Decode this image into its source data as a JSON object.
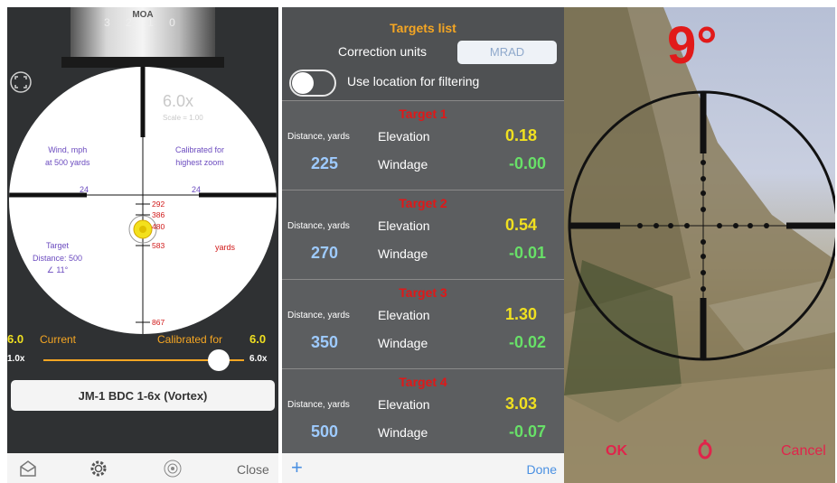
{
  "left_panel": {
    "turret": {
      "label": "MOA",
      "numbers": "3 2 1 0"
    },
    "reticle": {
      "zoom_display": "6.0x",
      "scale_text": "Scale = 1.00",
      "wind_label_line1": "Wind, mph",
      "wind_label_line2": "at 500 yards",
      "calibrated_line1": "Calibrated for",
      "calibrated_line2": "highest zoom",
      "wind_left_value": "24",
      "wind_right_value": "24",
      "holdover_marks": [
        "292",
        "386",
        "480",
        "583",
        "867"
      ],
      "target_line1": "Target",
      "target_line2": "Distance: 500",
      "target_line3": "∠ 11°",
      "yards_label": "yards"
    },
    "zoom_slider": {
      "current_value": "6.0",
      "current_label": "Current",
      "calibrated_label": "Calibrated for",
      "calibrated_value": "6.0",
      "min_label": "1.0x",
      "max_label": "6.0x",
      "position_fraction": 1.0
    },
    "reticle_name": "JM-1 BDC 1-6x (Vortex)"
  },
  "toolbar_left": {
    "items": [
      "share-icon",
      "gear-icon",
      "target-icon"
    ],
    "close_label": "Close"
  },
  "middle_panel": {
    "title": "Targets list",
    "correction_units_label": "Correction units",
    "correction_units_value": "MRAD",
    "use_location_label": "Use location for filtering",
    "use_location_on": false,
    "targets": [
      {
        "title": "Target 1",
        "distance_label": "Distance, yards",
        "distance": "225",
        "elevation_label": "Elevation",
        "elevation": "0.18",
        "windage_label": "Windage",
        "windage": "-0.00"
      },
      {
        "title": "Target 2",
        "distance_label": "Distance, yards",
        "distance": "270",
        "elevation_label": "Elevation",
        "elevation": "0.54",
        "windage_label": "Windage",
        "windage": "-0.01"
      },
      {
        "title": "Target 3",
        "distance_label": "Distance, yards",
        "distance": "350",
        "elevation_label": "Elevation",
        "elevation": "1.30",
        "windage_label": "Windage",
        "windage": "-0.02"
      },
      {
        "title": "Target 4",
        "distance_label": "Distance, yards",
        "distance": "500",
        "elevation_label": "Elevation",
        "elevation": "3.03",
        "windage_label": "Windage",
        "windage": "-0.07"
      }
    ]
  },
  "toolbar_mid": {
    "add_label": "+",
    "done_label": "Done"
  },
  "right_panel": {
    "angle": "9°",
    "ok_label": "OK",
    "reset_label": "0",
    "cancel_label": "Cancel"
  },
  "colors": {
    "accent_orange": "#f5a623",
    "target_red": "#e01818",
    "elevation_yellow": "#f0e020",
    "windage_green": "#68e068",
    "distance_blue": "#9ecbff",
    "ios_blue": "#4a90e2"
  }
}
